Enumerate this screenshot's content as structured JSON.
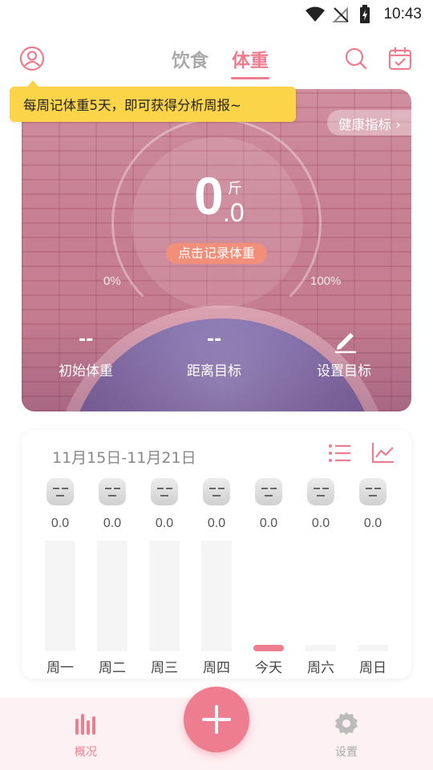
{
  "status_bar": {
    "time": "10:43"
  },
  "header": {
    "tabs": [
      {
        "label": "饮食",
        "active": false
      },
      {
        "label": "体重",
        "active": true
      }
    ],
    "accent_color": "#ef7d90"
  },
  "tooltip": {
    "text": "每周记体重5天，即可获得分析周报~"
  },
  "hero": {
    "health_link": "健康指标 ›",
    "weight_int": "0",
    "weight_dec": ".0",
    "unit": "斤",
    "record_button": "点击记录体重",
    "pct_start": "0%",
    "pct_end": "100%",
    "stats": [
      {
        "value": "--",
        "label": "初始体重"
      },
      {
        "value": "--",
        "label": "距离目标"
      },
      {
        "label": "设置目标"
      }
    ]
  },
  "week": {
    "range": "11月15日-11月21日",
    "days": [
      {
        "name": "周一",
        "value": "0.0",
        "today": false
      },
      {
        "name": "周二",
        "value": "0.0",
        "today": false
      },
      {
        "name": "周三",
        "value": "0.0",
        "today": false
      },
      {
        "name": "周四",
        "value": "0.0",
        "today": false
      },
      {
        "name": "今天",
        "value": "0.0",
        "today": true
      },
      {
        "name": "周六",
        "value": "0.0",
        "today": false
      },
      {
        "name": "周日",
        "value": "0.0",
        "today": false
      }
    ]
  },
  "bottom_nav": {
    "items": [
      {
        "label": "概况",
        "icon": "bar-chart-icon",
        "active": true
      },
      {
        "label": "设置",
        "icon": "gear-icon",
        "active": false
      }
    ]
  }
}
